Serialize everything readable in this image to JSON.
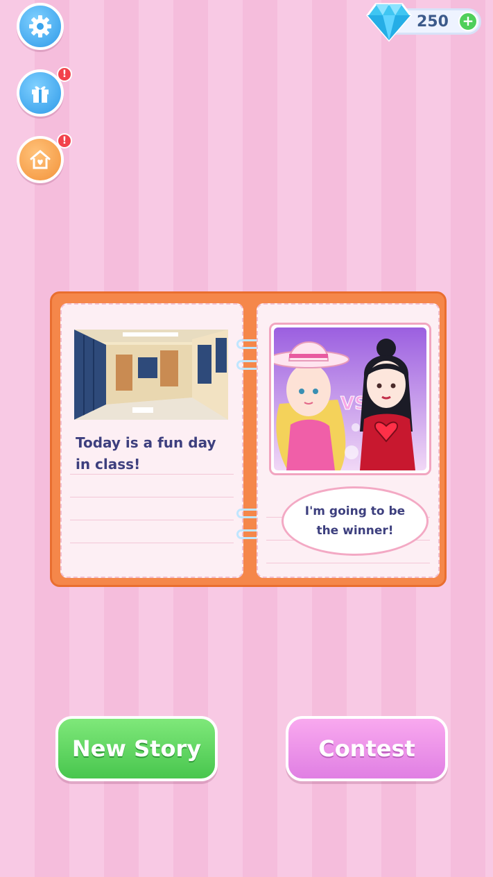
{
  "header": {
    "settings_icon": "gear-icon",
    "gift_icon": "gift-icon",
    "home_icon": "house-heart-icon",
    "gift_badge": "!",
    "home_badge": "!",
    "currency": {
      "icon": "diamond-icon",
      "value": "250",
      "add_label": "+"
    }
  },
  "book": {
    "left_page": {
      "text": "Today is a fun day in class!",
      "image": "school-hallway-image"
    },
    "right_page": {
      "image": "cowgirl-vs-gothic-girl-image",
      "vs_label": "VS",
      "bubble_text": "I'm going to be the winner!"
    }
  },
  "buttons": {
    "new_story": "New Story",
    "contest": "Contest"
  },
  "colors": {
    "background": "#f8c9e4",
    "book": "#f5874a",
    "green_button": "#48c64e",
    "pink_button": "#e07fe3",
    "text": "#3d3f7e"
  }
}
